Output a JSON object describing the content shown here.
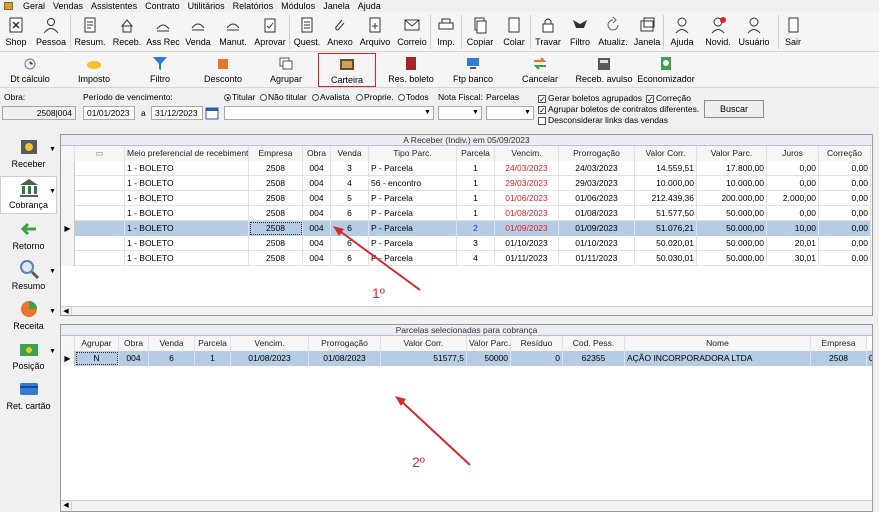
{
  "menu": [
    "Geral",
    "Vendas",
    "Assistentes",
    "Contrato",
    "Utilitários",
    "Relatórios",
    "Módulos",
    "Janela",
    "Ajuda"
  ],
  "toolbar1": [
    {
      "label": "Shop",
      "icon": "shop-icon"
    },
    {
      "label": "Pessoa",
      "icon": "person-icon"
    },
    {
      "label": "Resum.",
      "icon": "document-icon"
    },
    {
      "label": "Receb.",
      "icon": "receive-icon"
    },
    {
      "label": "Ass Rec",
      "icon": "sign-receipt-icon"
    },
    {
      "label": "Venda",
      "icon": "sale-icon"
    },
    {
      "label": "Manut.",
      "icon": "maintenance-icon"
    },
    {
      "label": "Aprovar",
      "icon": "approve-icon"
    },
    {
      "label": "Quest.",
      "icon": "questionnaire-icon"
    },
    {
      "label": "Anexo",
      "icon": "paperclip-icon"
    },
    {
      "label": "Arquivo",
      "icon": "file-add-icon"
    },
    {
      "label": "Correio",
      "icon": "mail-icon"
    },
    {
      "label": "Imp.",
      "icon": "printer-icon"
    },
    {
      "label": "Copiar",
      "icon": "copy-icon"
    },
    {
      "label": "Colar",
      "icon": "paste-icon"
    },
    {
      "label": "Travar",
      "icon": "lock-icon"
    },
    {
      "label": "Filtro",
      "icon": "filter-icon"
    },
    {
      "label": "Atualiz.",
      "icon": "refresh-icon"
    },
    {
      "label": "Janela",
      "icon": "window-icon"
    },
    {
      "label": "Ajuda",
      "icon": "help-icon"
    },
    {
      "label": "Novid.",
      "icon": "news-icon"
    },
    {
      "label": "Usuário",
      "icon": "user-icon"
    },
    {
      "label": "Sair",
      "icon": "exit-icon"
    }
  ],
  "toolbar2": [
    {
      "label": "Dt cálculo",
      "icon": "calc-date-icon"
    },
    {
      "label": "Imposto",
      "icon": "tax-icon"
    },
    {
      "label": "Filtro",
      "icon": "funnel-icon"
    },
    {
      "label": "Desconto",
      "icon": "discount-icon"
    },
    {
      "label": "Agrupar",
      "icon": "group-icon"
    },
    {
      "label": "Carteira",
      "icon": "wallet-icon"
    },
    {
      "label": "Res. boleto",
      "icon": "book-icon"
    },
    {
      "label": "Ftp banco",
      "icon": "ftp-icon"
    },
    {
      "label": "Cancelar",
      "icon": "cancel-icon"
    },
    {
      "label": "Receb. avulso",
      "icon": "cash-register-icon"
    },
    {
      "label": "Economizador",
      "icon": "saver-icon"
    }
  ],
  "filters": {
    "obra_label": "Obra:",
    "obra_value": "2508|004",
    "periodo_label": "Período de vencimento:",
    "date_from": "01/01/2023",
    "a_label": "a",
    "date_to": "31/12/2023",
    "radio_titular": "Titular",
    "radio_nao_titular": "Não titular",
    "radio_avalista": "Avalista",
    "radio_proprie": "Proprie.",
    "radio_todos": "Todos",
    "nota_fiscal_label": "Nota Fiscal:",
    "parcelas_label": "Parcelas",
    "chk_gerar": "Gerar boletos agrupados",
    "chk_correcao": "Correção",
    "chk_agrupar": "Agrupar boletos de contratos diferentes.",
    "chk_desconsiderar": "Desconsiderar links das vendas",
    "buscar": "Buscar"
  },
  "sidebar": [
    {
      "label": "Receber",
      "icon": "receive-money-icon"
    },
    {
      "label": "Cobrança",
      "icon": "bank-icon"
    },
    {
      "label": "Retorno",
      "icon": "return-arrow-icon"
    },
    {
      "label": "Resumo",
      "icon": "magnifier-icon"
    },
    {
      "label": "Receita",
      "icon": "revenue-icon"
    },
    {
      "label": "Posição",
      "icon": "position-icon"
    },
    {
      "label": "Ret. cartão",
      "icon": "card-icon"
    }
  ],
  "grid1": {
    "title": "A Receber (Indiv.) em 05/09/2023",
    "headers": [
      "Meio preferencial de recebimento",
      "Empresa",
      "Obra",
      "Venda",
      "Tipo Parc.",
      "Parcela",
      "Vencim.",
      "Prorrogação",
      "Valor Corr.",
      "Valor Parc.",
      "Juros",
      "Correção"
    ],
    "rows": [
      [
        "1 - BOLETO",
        "2508",
        "004",
        "3",
        "P - Parcela",
        "1",
        "24/03/2023",
        "24/03/2023",
        "14.559,51",
        "17.800,00",
        "0,00",
        "0,00"
      ],
      [
        "1 - BOLETO",
        "2508",
        "004",
        "4",
        "56 - encontro",
        "1",
        "29/03/2023",
        "29/03/2023",
        "10.000,00",
        "10.000,00",
        "0,00",
        "0,00"
      ],
      [
        "1 - BOLETO",
        "2508",
        "004",
        "5",
        "P - Parcela",
        "1",
        "01/06/2023",
        "01/06/2023",
        "212.439,36",
        "200.000,00",
        "2.000,00",
        "0,00"
      ],
      [
        "1 - BOLETO",
        "2508",
        "004",
        "6",
        "P - Parcela",
        "1",
        "01/08/2023",
        "01/08/2023",
        "51.577,50",
        "50.000,00",
        "0,00",
        "0,00"
      ],
      [
        "1 - BOLETO",
        "2508",
        "004",
        "6",
        "P - Parcela",
        "2",
        "01/09/2023",
        "01/09/2023",
        "51.076,21",
        "50.000,00",
        "10,00",
        "0,00"
      ],
      [
        "1 - BOLETO",
        "2508",
        "004",
        "6",
        "P - Parcela",
        "3",
        "01/10/2023",
        "01/10/2023",
        "50.020,01",
        "50.000,00",
        "20,01",
        "0,00"
      ],
      [
        "1 - BOLETO",
        "2508",
        "004",
        "6",
        "P - Parcela",
        "4",
        "01/11/2023",
        "01/11/2023",
        "50.030,01",
        "50.000,00",
        "30,01",
        "0,00"
      ]
    ],
    "red_vencim_rows": [
      0,
      1,
      2,
      3,
      4
    ],
    "selected_row": 4
  },
  "grid2": {
    "title": "Parcelas selecionadas para cobrança",
    "headers": [
      "Agrupar",
      "Obra",
      "Venda",
      "Parcela",
      "Vencim.",
      "Prorrogação",
      "Valor Corr.",
      "Valor Parc.",
      "Resíduo",
      "Cod. Pess.",
      "Nome",
      "Empresa"
    ],
    "rows": [
      [
        "N",
        "004",
        "6",
        "1",
        "01/08/2023",
        "01/08/2023",
        "51577,5",
        "50000",
        "0",
        "62355",
        "AÇÃO INCORPORADORA LTDA",
        "2508",
        "0"
      ]
    ]
  },
  "annotations": {
    "first": "1º",
    "second": "2º"
  },
  "colors": {
    "accent_red": "#e0212a",
    "selection": "#b6cce4",
    "arrow": "#d72c2c"
  }
}
